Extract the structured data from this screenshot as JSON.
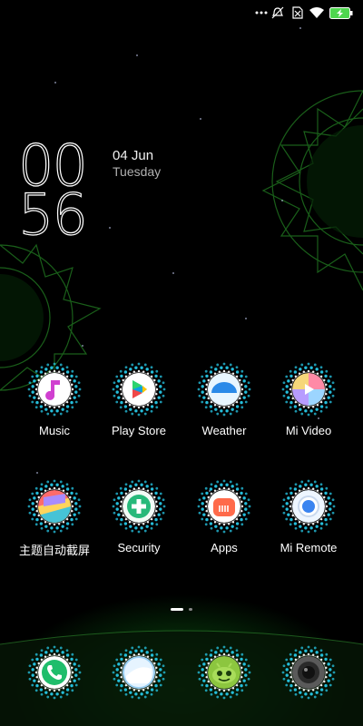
{
  "status_bar": {
    "icons": [
      "more-dots-icon",
      "mute-icon",
      "no-sim-icon",
      "wifi-icon",
      "battery-charging-icon"
    ]
  },
  "clock": {
    "hours": "00",
    "minutes": "56",
    "date": "04 Jun",
    "day": "Tuesday"
  },
  "apps": [
    {
      "label": "Music",
      "icon": "music-icon"
    },
    {
      "label": "Play Store",
      "icon": "play-store-icon"
    },
    {
      "label": "Weather",
      "icon": "weather-icon"
    },
    {
      "label": "Mi Video",
      "icon": "video-icon"
    },
    {
      "label": "主题自动截屏",
      "icon": "theme-screenshot-icon"
    },
    {
      "label": "Security",
      "icon": "security-icon"
    },
    {
      "label": "Apps",
      "icon": "mi-apps-icon"
    },
    {
      "label": "Mi Remote",
      "icon": "remote-icon"
    }
  ],
  "dock": [
    {
      "icon": "phone-icon"
    },
    {
      "icon": "messaging-icon"
    },
    {
      "icon": "browser-icon"
    },
    {
      "icon": "camera-icon"
    }
  ],
  "page_indicator": {
    "pages": 2,
    "current": 1
  },
  "colors": {
    "accent": "#1fd0d8",
    "wallpaper_glow": "#0e4a12",
    "ring_dot": "#27c7e6"
  }
}
